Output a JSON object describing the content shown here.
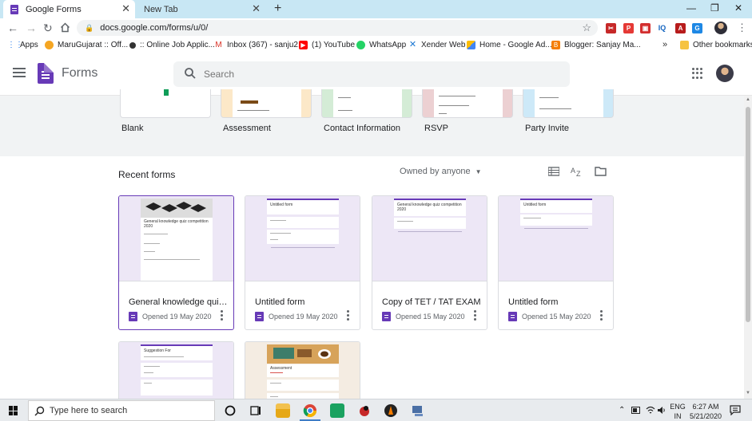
{
  "browser": {
    "tabs": [
      {
        "title": "Google Forms",
        "active": true
      },
      {
        "title": "New Tab",
        "active": false
      }
    ],
    "url": "docs.google.com/forms/u/0/",
    "bookmarks": [
      {
        "label": "Apps",
        "icon": "apps-grid-icon"
      },
      {
        "label": "MaruGujarat :: Off...",
        "icon": "marugujarat-icon"
      },
      {
        "label": ":: Online Job Applic...",
        "icon": "job-icon"
      },
      {
        "label": "Inbox (367) - sanju2...",
        "icon": "gmail-icon"
      },
      {
        "label": "(1) YouTube",
        "icon": "youtube-icon"
      },
      {
        "label": "WhatsApp",
        "icon": "whatsapp-icon"
      },
      {
        "label": "Xender Web",
        "icon": "xender-icon"
      },
      {
        "label": "Home - Google Ad...",
        "icon": "google-ads-icon"
      },
      {
        "label": "Blogger: Sanjay Ma...",
        "icon": "blogger-icon"
      }
    ],
    "more_bookmarks": "»",
    "other_bookmarks": "Other bookmarks"
  },
  "app": {
    "title": "Forms",
    "search_placeholder": "Search"
  },
  "templates": [
    {
      "label": "Blank"
    },
    {
      "label": "Assessment"
    },
    {
      "label": "Contact Information"
    },
    {
      "label": "RSVP"
    },
    {
      "label": "Party Invite"
    }
  ],
  "recent": {
    "title": "Recent forms",
    "owner_filter": "Owned by anyone",
    "forms": [
      {
        "title": "General knowledge quiz ...",
        "opened": "Opened 19 May 2020",
        "thumb_title": "General knowledge quiz competition 2020"
      },
      {
        "title": "Untitled form",
        "opened": "Opened 19 May 2020",
        "thumb_title": "Untitled form"
      },
      {
        "title": "Copy of TET / TAT EXAM",
        "opened": "Opened 15 May 2020",
        "thumb_title": "General knowledge quiz competition 2020"
      },
      {
        "title": "Untitled form",
        "opened": "Opened 15 May 2020",
        "thumb_title": "Untitled form"
      },
      {
        "thumb_title": "Suggestion For"
      },
      {
        "thumb_title": "Assessment"
      }
    ]
  },
  "taskbar": {
    "search_placeholder": "Type here to search",
    "language": "ENG",
    "region": "IN",
    "time": "6:27 AM",
    "date": "5/21/2020"
  },
  "colors": {
    "forms_purple": "#673ab7",
    "tab_strip": "#c8e7f4",
    "gallery_bg": "#f1f3f4"
  }
}
